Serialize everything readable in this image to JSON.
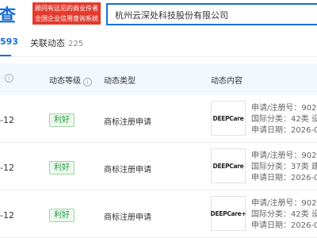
{
  "header": {
    "logo_text": "查",
    "slogan_line1": "顾问有远见的商业伶者",
    "slogan_line2": "全国企业信用查询系统",
    "search_value": "杭州云深处科技股份有限公司"
  },
  "tabs": {
    "active_count": "593",
    "related_label": "关联动态",
    "related_count": "225"
  },
  "table": {
    "headers": {
      "level": "动态等级",
      "type": "动态类型",
      "content": "动态内容"
    },
    "info_icon": "i",
    "rows": [
      {
        "date": "-12",
        "level": "利好",
        "type": "商标注册申请",
        "brand": "DEEPCare",
        "reg_no": "申请/注册号：902",
        "intl_class": "国际分类：42类 设",
        "apply_date": "申请日期：2026-0"
      },
      {
        "date": "-12",
        "level": "利好",
        "type": "商标注册申请",
        "brand": "DEEPCare",
        "reg_no": "申请/注册号：902",
        "intl_class": "国际分类：37类 建",
        "apply_date": "申请日期：2026-0"
      },
      {
        "date": "-12",
        "level": "利好",
        "type": "商标注册申请",
        "brand": "DEEPCare+",
        "reg_no": "申请/注册号：902",
        "intl_class": "国际分类：42类 设",
        "apply_date": "申请日期：2026-0"
      }
    ]
  },
  "colors": {
    "brand_blue": "#1a6fd6",
    "slogan_red": "#e23b2e",
    "positive_green": "#1e9b3a",
    "header_bg": "#f3f7fe"
  }
}
